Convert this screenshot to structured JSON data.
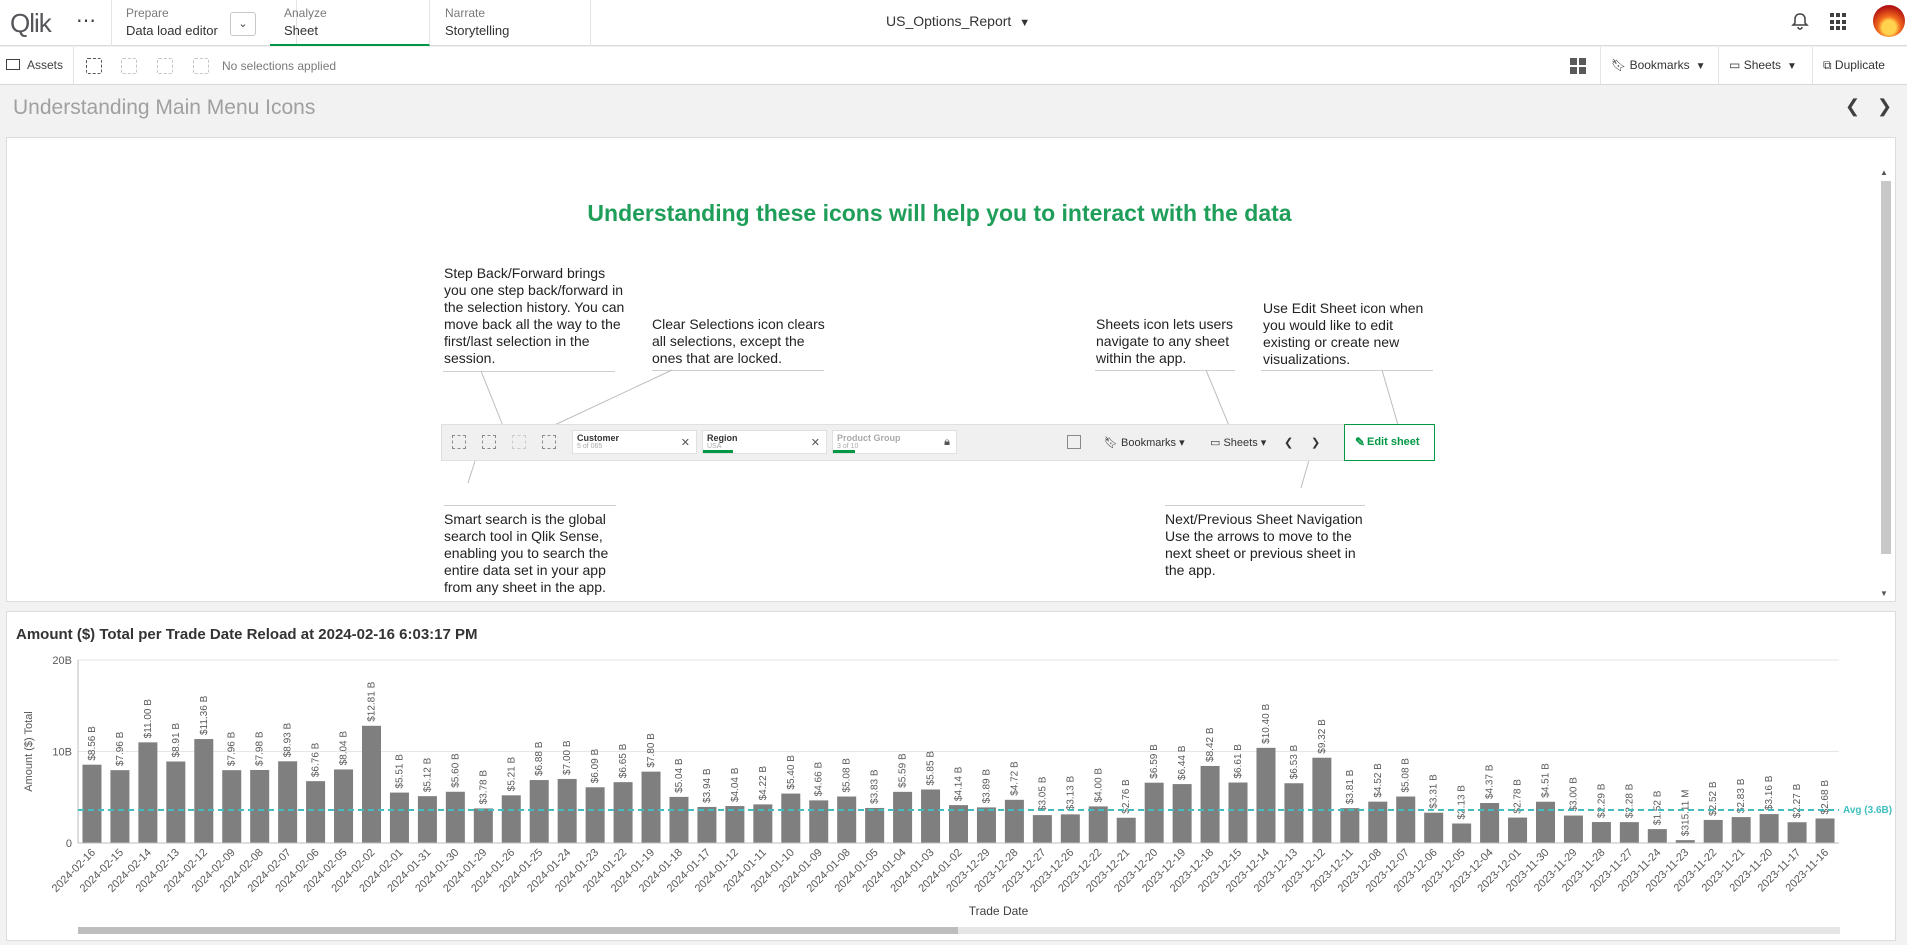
{
  "topbar": {
    "logo": "Qlik",
    "prepare": {
      "label": "Prepare",
      "value": "Data load editor"
    },
    "analyze": {
      "label": "Analyze",
      "value": "Sheet"
    },
    "narrate": {
      "label": "Narrate",
      "value": "Storytelling"
    },
    "app_title": "US_Options_Report"
  },
  "toolbar": {
    "assets": "Assets",
    "no_selections": "No selections applied",
    "bookmarks": "Bookmarks",
    "sheets": "Sheets",
    "duplicate": "Duplicate"
  },
  "sheet_title": "Understanding Main Menu Icons",
  "info": {
    "heading": "Understanding these icons will help you to interact with the data",
    "callouts": {
      "step": "Step Back/Forward brings you one step back/forward in the selection history. You can move back all the way to the first/last selection in the session.",
      "clear": "Clear Selections icon clears all selections, except the ones that are locked.",
      "sheets": "Sheets icon lets users navigate to any sheet within the app.",
      "edit": "Use Edit Sheet icon when you would like to edit existing or create new visualizations.",
      "search": "Smart search is the global search tool in Qlik Sense, enabling you to search the entire data set in your app from any sheet in the app.",
      "nav": "Next/Previous Sheet Navigation Use the arrows to move to the next sheet or previous sheet in the app."
    },
    "mock_bar": {
      "customer": "Customer",
      "customer_sub": "5 of 065",
      "region": "Region",
      "region_sub": "USA",
      "product": "Product Group",
      "product_sub": "3 of 10",
      "bookmarks": "Bookmarks",
      "sheets": "Sheets",
      "edit": "Edit sheet"
    }
  },
  "chart_data": {
    "type": "bar",
    "title": "Amount ($) Total per Trade Date Reload at 2024-02-16 6:03:17 PM",
    "xlabel": "Trade Date",
    "ylabel": "Amount ($) Total",
    "yticks": [
      "20B",
      "10B",
      "0"
    ],
    "ylim": [
      0,
      20
    ],
    "avg_value": 3.6,
    "avg_label": "Avg (3.6B)",
    "colors": {
      "bar": "#7f7f7f",
      "avg": "#3fbfbf"
    },
    "categories": [
      "2024-02-16",
      "2024-02-15",
      "2024-02-14",
      "2024-02-13",
      "2024-02-12",
      "2024-02-09",
      "2024-02-08",
      "2024-02-07",
      "2024-02-06",
      "2024-02-05",
      "2024-02-02",
      "2024-02-01",
      "2024-01-31",
      "2024-01-30",
      "2024-01-29",
      "2024-01-26",
      "2024-01-25",
      "2024-01-24",
      "2024-01-23",
      "2024-01-22",
      "2024-01-19",
      "2024-01-18",
      "2024-01-17",
      "2024-01-12",
      "2024-01-11",
      "2024-01-10",
      "2024-01-09",
      "2024-01-08",
      "2024-01-05",
      "2024-01-04",
      "2024-01-03",
      "2024-01-02",
      "2023-12-29",
      "2023-12-28",
      "2023-12-27",
      "2023-12-26",
      "2023-12-22",
      "2023-12-21",
      "2023-12-20",
      "2023-12-19",
      "2023-12-18",
      "2023-12-15",
      "2023-12-14",
      "2023-12-13",
      "2023-12-12",
      "2023-12-11",
      "2023-12-08",
      "2023-12-07",
      "2023-12-06",
      "2023-12-05",
      "2023-12-04",
      "2023-12-01",
      "2023-11-30",
      "2023-11-29",
      "2023-11-28",
      "2023-11-27",
      "2023-11-24",
      "2023-11-23",
      "2023-11-22",
      "2023-11-21",
      "2023-11-20",
      "2023-11-17",
      "2023-11-16"
    ],
    "values": [
      8.56,
      7.96,
      11.0,
      8.91,
      11.36,
      7.96,
      7.98,
      8.93,
      6.76,
      8.04,
      12.81,
      5.51,
      5.12,
      5.6,
      3.78,
      5.21,
      6.88,
      7.0,
      6.09,
      6.65,
      7.8,
      5.04,
      3.94,
      4.04,
      4.22,
      5.4,
      4.66,
      5.08,
      3.83,
      5.59,
      5.85,
      4.14,
      3.89,
      4.72,
      3.05,
      3.13,
      4.0,
      2.76,
      6.59,
      6.44,
      8.42,
      6.61,
      10.4,
      6.53,
      9.32,
      3.81,
      4.52,
      5.08,
      3.31,
      2.13,
      4.37,
      2.78,
      4.51,
      3.0,
      2.29,
      2.28,
      1.52,
      0.31511,
      2.52,
      2.83,
      3.16,
      2.27,
      2.68
    ],
    "labels": [
      "$8.56 B",
      "$7.96 B",
      "$11.00 B",
      "$8.91 B",
      "$11.36 B",
      "$7.96 B",
      "$7.98 B",
      "$8.93 B",
      "$6.76 B",
      "$8.04 B",
      "$12.81 B",
      "$5.51 B",
      "$5.12 B",
      "$5.60 B",
      "$3.78 B",
      "$5.21 B",
      "$6.88 B",
      "$7.00 B",
      "$6.09 B",
      "$6.65 B",
      "$7.80 B",
      "$5.04 B",
      "$3.94 B",
      "$4.04 B",
      "$4.22 B",
      "$5.40 B",
      "$4.66 B",
      "$5.08 B",
      "$3.83 B",
      "$5.59 B",
      "$5.85 B",
      "$4.14 B",
      "$3.89 B",
      "$4.72 B",
      "$3.05 B",
      "$3.13 B",
      "$4.00 B",
      "$2.76 B",
      "$6.59 B",
      "$6.44 B",
      "$8.42 B",
      "$6.61 B",
      "$10.40 B",
      "$6.53 B",
      "$9.32 B",
      "$3.81 B",
      "$4.52 B",
      "$5.08 B",
      "$3.31 B",
      "$2.13 B",
      "$4.37 B",
      "$2.78 B",
      "$4.51 B",
      "$3.00 B",
      "$2.29 B",
      "$2.28 B",
      "$1.52 B",
      "$315.11 M",
      "$2.52 B",
      "$2.83 B",
      "$3.16 B",
      "$2.27 B",
      "$2.68 B"
    ],
    "grid": true
  }
}
